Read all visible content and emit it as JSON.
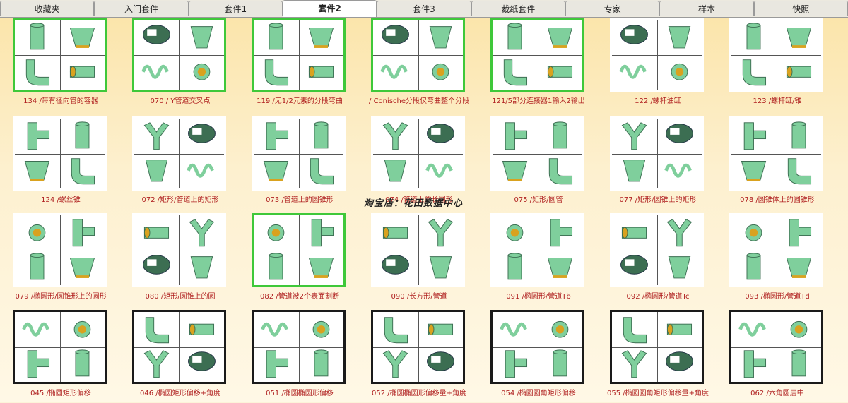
{
  "tabs": [
    {
      "label": "收藏夹"
    },
    {
      "label": "入门套件"
    },
    {
      "label": "套件1"
    },
    {
      "label": "套件2",
      "active": true
    },
    {
      "label": "套件3"
    },
    {
      "label": "裁纸套件"
    },
    {
      "label": "专家"
    },
    {
      "label": "样本"
    },
    {
      "label": "快照"
    }
  ],
  "watermark": "淘宝店：花田数据中心",
  "colors": {
    "shape_fill": "#7fcf9c",
    "shape_dark": "#3c6e52",
    "inner": "#d9a21f",
    "green_border": "#3fc83a",
    "caption": "#b02020"
  },
  "rows": [
    [
      {
        "caption": "134 /带有径向管的容器",
        "border": "green"
      },
      {
        "caption": "070 / Y管道交叉点",
        "border": "green"
      },
      {
        "caption": "119 /无1/2元素的分段弯曲",
        "border": "green"
      },
      {
        "caption": "/ Conische分段仅弯曲整个分段",
        "border": "green"
      },
      {
        "caption": "121/5部分连接器1输入2输出",
        "border": "green"
      },
      {
        "caption": "122 /螺杆油缸",
        "border": "none"
      },
      {
        "caption": "123 /螺杆缸/锥",
        "border": "none"
      }
    ],
    [
      {
        "caption": "124 /螺丝锥",
        "border": "none"
      },
      {
        "caption": "072 /矩形/管道上的矩形",
        "border": "none"
      },
      {
        "caption": "073 /管道上的圆锥形",
        "border": "none"
      },
      {
        "caption": "074 /管道上的长圆形",
        "border": "none"
      },
      {
        "caption": "075 /矩形/圆管",
        "border": "none"
      },
      {
        "caption": "077 /矩形/圆锥上的矩形",
        "border": "none"
      },
      {
        "caption": "078 /圆锥体上的圆锥形",
        "border": "none"
      }
    ],
    [
      {
        "caption": "079 /椭圆形/圆锥形上的圆形",
        "border": "none"
      },
      {
        "caption": "080 /矩形/圆锥上的圆",
        "border": "none"
      },
      {
        "caption": "082 /管道被2个表面割断",
        "border": "green"
      },
      {
        "caption": "090 /长方形/管道",
        "border": "none"
      },
      {
        "caption": "091 /椭圆形/管道Tb",
        "border": "none"
      },
      {
        "caption": "092 /椭圆形/管道Tc",
        "border": "none"
      },
      {
        "caption": "093 /椭圆形/管道Td",
        "border": "none"
      }
    ],
    [
      {
        "caption": "045 /椭圆矩形偏移",
        "border": "black"
      },
      {
        "caption": "046 /椭圆矩形偏移+角度",
        "border": "black"
      },
      {
        "caption": "051 /椭圆椭圆形偏移",
        "border": "black"
      },
      {
        "caption": "052 /椭圆椭圆形偏移量+角度",
        "border": "black"
      },
      {
        "caption": "054 /椭圆圆角矩形偏移",
        "border": "black"
      },
      {
        "caption": "055 /椭圆圆角矩形偏移量+角度",
        "border": "black"
      },
      {
        "caption": "062 /六角圆居中",
        "border": "black"
      }
    ]
  ]
}
